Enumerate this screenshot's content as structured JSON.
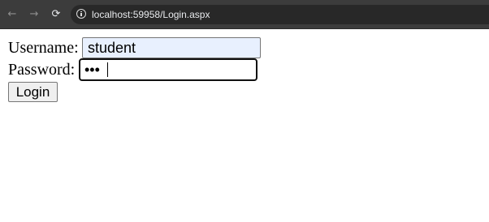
{
  "browser": {
    "back_icon": "arrow-left-icon",
    "forward_icon": "arrow-right-icon",
    "reload_icon": "reload-icon",
    "info_icon": "info-icon",
    "url": "localhost:59958/Login.aspx"
  },
  "form": {
    "username_label": "Username:",
    "username_value": "student",
    "password_label": "Password:",
    "password_value": "***",
    "login_label": "Login"
  },
  "colors": {
    "toolbar": "#3c3c3c",
    "address_bar": "#282828",
    "autofill_bg": "#e8f0fe"
  }
}
